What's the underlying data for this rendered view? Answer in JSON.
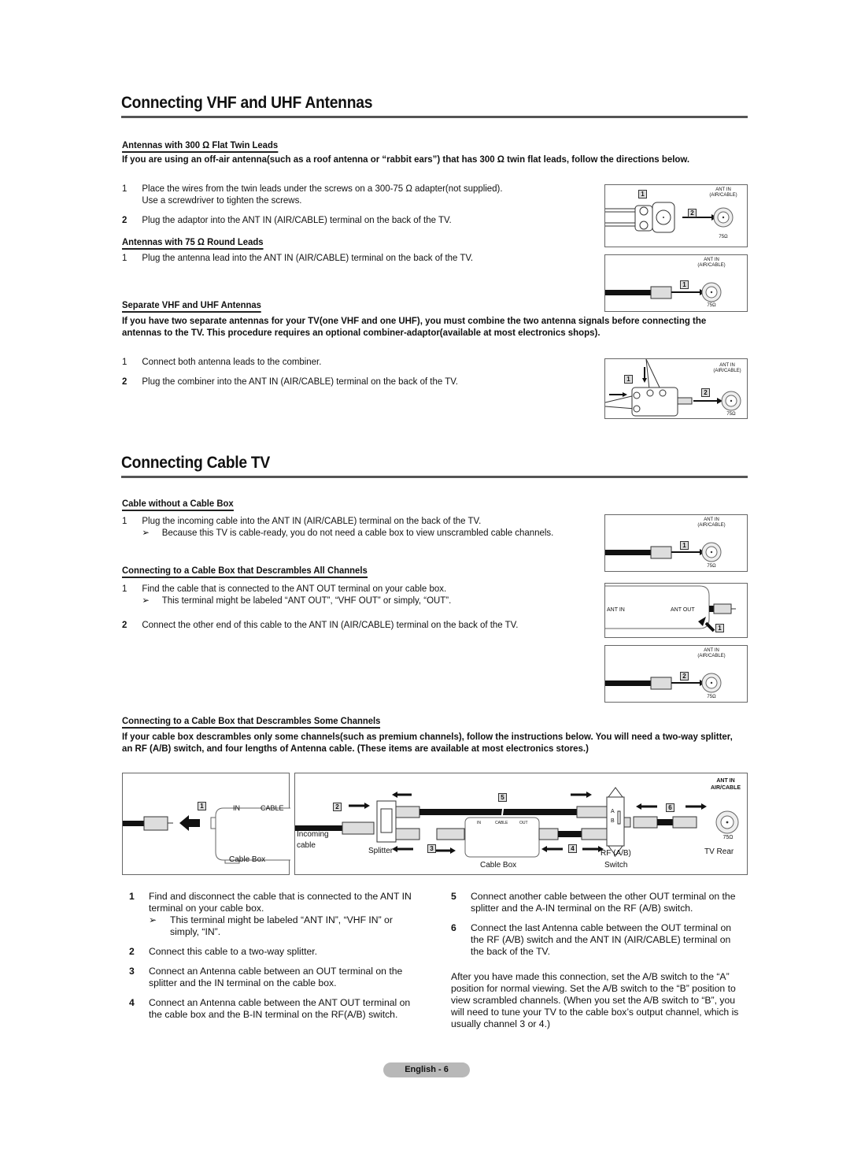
{
  "vhf_section": {
    "title": "Connecting VHF and UHF Antennas",
    "flat_twin": {
      "heading": "Antennas with 300 Ω Flat Twin Leads",
      "intro": "If you are using an off-air antenna(such as a roof antenna or “rabbit ears”) that has 300 Ω twin flat leads, follow the directions below.",
      "steps": [
        {
          "num": "1",
          "text": "Place the wires from the twin leads under the screws on a 300-75 Ω adapter(not supplied).",
          "text2": "Use a screwdriver to tighten the screws."
        },
        {
          "num": "2",
          "text": "Plug the adaptor into the ANT IN (AIR/CABLE) terminal on the back of the TV."
        }
      ]
    },
    "round_leads": {
      "heading": "Antennas with 75 Ω Round Leads",
      "steps": [
        {
          "num": "1",
          "text": "Plug the antenna lead into the ANT IN (AIR/CABLE) terminal on the back of the TV."
        }
      ]
    },
    "separate": {
      "heading": "Separate VHF and UHF Antennas",
      "intro": "If you have two separate antennas for your TV(one VHF and one UHF), you must combine the two antenna signals before connecting the antennas to the TV. This procedure requires an optional combiner-adaptor(available at most electronics shops).",
      "steps": [
        {
          "num": "1",
          "text": "Connect both antenna leads to the combiner."
        },
        {
          "num": "2",
          "text": "Plug the combiner into the ANT IN (AIR/CABLE) terminal on the back of the TV."
        }
      ]
    }
  },
  "cable_section": {
    "title": "Connecting Cable TV",
    "no_box": {
      "heading": "Cable without a Cable Box",
      "steps": [
        {
          "num": "1",
          "text": "Plug the incoming cable into the ANT IN (AIR/CABLE) terminal on the back of the TV.",
          "note": "Because this TV is cable-ready, you do not need a cable box to view unscrambled cable channels."
        }
      ]
    },
    "all_channels": {
      "heading": "Connecting to a Cable Box that Descrambles All Channels",
      "steps": [
        {
          "num": "1",
          "text": "Find the cable that is connected to the ANT OUT terminal on your cable box.",
          "note": "This terminal might be labeled “ANT OUT”, “VHF OUT” or simply, “OUT”."
        },
        {
          "num": "2",
          "text": "Connect the other end of this cable to the ANT IN (AIR/CABLE) terminal on the back of the TV."
        }
      ]
    },
    "some_channels": {
      "heading": "Connecting to a Cable Box that Descrambles Some Channels",
      "intro": "If your cable box descrambles only some channels(such as premium channels), follow the instructions below. You will need a two-way splitter, an RF (A/B) switch, and four lengths of Antenna cable. (These items are available at most electronics stores.)",
      "left_steps": [
        {
          "num": "1",
          "text": "Find and disconnect the cable that is connected to the ANT IN terminal on your cable box.",
          "note": "This terminal might be labeled “ANT IN”, “VHF IN” or simply, “IN”."
        },
        {
          "num": "2",
          "text": "Connect this cable to a two-way splitter."
        },
        {
          "num": "3",
          "text": "Connect an Antenna cable between an OUT terminal on the splitter and the IN terminal on the cable box."
        },
        {
          "num": "4",
          "text": "Connect an Antenna cable between the ANT OUT terminal on the cable box and the B-IN terminal on the RF(A/B) switch."
        }
      ],
      "right_steps": [
        {
          "num": "5",
          "text": "Connect another cable between the other OUT terminal on the splitter and the A-IN terminal on the RF (A/B) switch."
        },
        {
          "num": "6",
          "text": "Connect the last Antenna cable between the OUT terminal on the RF (A/B) switch and the ANT IN (AIR/CABLE) terminal on the back of the TV."
        }
      ],
      "closing": "After you have made this connection, set the A/B switch to the “A” position for normal viewing. Set the A/B switch to the “B” position to view scrambled channels. (When you set the A/B switch to “B”, you will need to tune your TV to the cable box’s output channel, which is usually channel 3 or 4.)"
    }
  },
  "diagram_labels": {
    "ant_in": "ANT IN",
    "air_cable_paren": "(AIR/CABLE)",
    "air_cable": "AIR/CABLE",
    "ohm75": "75Ω",
    "ant_out": "ANT OUT",
    "in": "IN",
    "cable": "CABLE",
    "out": "OUT",
    "cable_box": "Cable Box",
    "incoming": "Incoming",
    "cable_lc": "cable",
    "splitter": "Splitter",
    "rf_ab": "RF (A/B)",
    "switch": "Switch",
    "tv_rear": "TV Rear",
    "a": "A",
    "b": "B",
    "n1": "1",
    "n2": "2",
    "n3": "3",
    "n4": "4",
    "n5": "5",
    "n6": "6"
  },
  "note_arrow": "➢",
  "footer": {
    "page_label": "English - 6"
  }
}
